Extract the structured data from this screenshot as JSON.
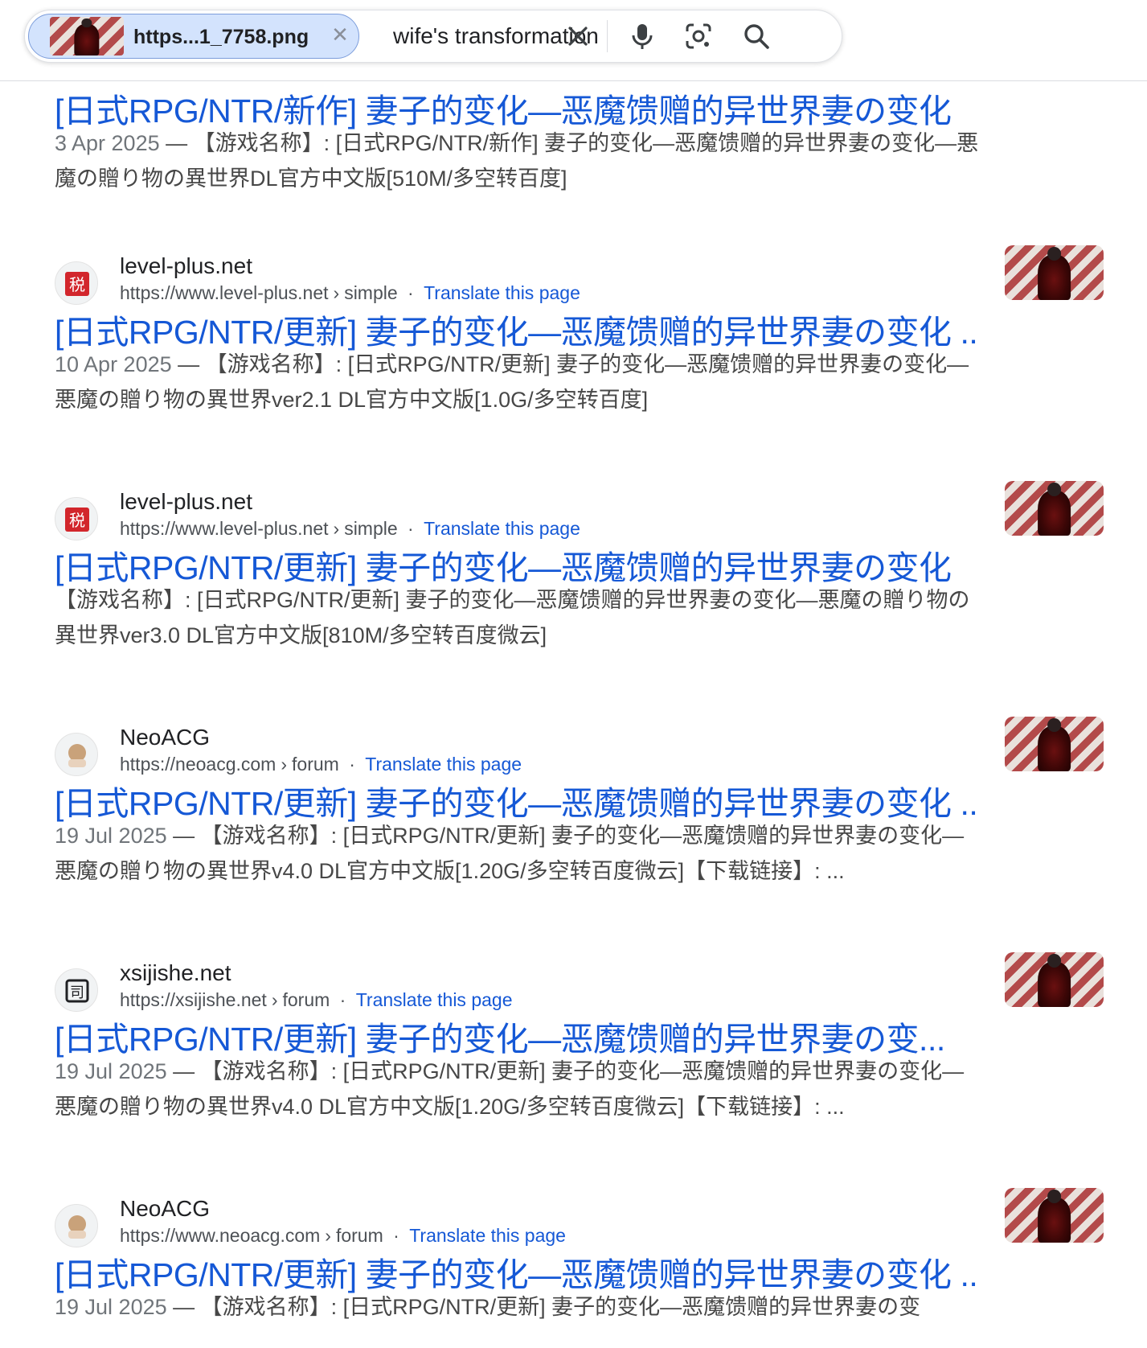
{
  "search": {
    "image_chip_label": "https...1_7758.png",
    "query": "wife's transformation"
  },
  "icons": {
    "chip_close": "close-icon",
    "clear": "close-icon",
    "voice": "microphone-icon",
    "lens": "camera-lens-icon",
    "search": "search-icon"
  },
  "colors": {
    "link_blue": "#1558d6",
    "chip_bg": "#d3e3fd"
  },
  "results": [
    {
      "site_name": "",
      "url": "",
      "breadcrumb": "",
      "translate": "",
      "title": "[日式RPG/NTR/新作] 妻子的变化—恶魔馈赠的异世界妻の变化",
      "date": "3 Apr 2025",
      "snippet": "【游戏名称】: [日式RPG/NTR/新作] 妻子的变化—恶魔馈赠的异世界妻の变化—悪魔の贈り物の異世界DL官方中文版[510M/多空转百度]"
    },
    {
      "site_name": "level-plus.net",
      "url": "https://www.level-plus.net",
      "breadcrumb": "simple",
      "translate": "Translate this page",
      "title": "[日式RPG/NTR/更新] 妻子的变化—恶魔馈赠的异世界妻の变化 ...",
      "date": "10 Apr 2025",
      "snippet": "【游戏名称】: [日式RPG/NTR/更新] 妻子的变化—恶魔馈赠的异世界妻の变化—悪魔の贈り物の異世界ver2.1 DL官方中文版[1.0G/多空转百度]"
    },
    {
      "site_name": "level-plus.net",
      "url": "https://www.level-plus.net",
      "breadcrumb": "simple",
      "translate": "Translate this page",
      "title": "[日式RPG/NTR/更新] 妻子的变化—恶魔馈赠的异世界妻の变化",
      "date": "",
      "snippet": "【游戏名称】: [日式RPG/NTR/更新] 妻子的变化—恶魔馈赠的异世界妻の变化—悪魔の贈り物の異世界ver3.0 DL官方中文版[810M/多空转百度微云]"
    },
    {
      "site_name": "NeoACG",
      "url": "https://neoacg.com",
      "breadcrumb": "forum",
      "translate": "Translate this page",
      "title": "[日式RPG/NTR/更新] 妻子的变化—恶魔馈赠的异世界妻の变化 ...",
      "date": "19 Jul 2025",
      "snippet": "【游戏名称】: [日式RPG/NTR/更新] 妻子的变化—恶魔馈赠的异世界妻の变化—悪魔の贈り物の異世界v4.0 DL官方中文版[1.20G/多空转百度微云]【下载链接】: ..."
    },
    {
      "site_name": "xsijishe.net",
      "url": "https://xsijishe.net",
      "breadcrumb": "forum",
      "translate": "Translate this page",
      "title": "[日式RPG/NTR/更新] 妻子的变化—恶魔馈赠的异世界妻の变...",
      "date": "19 Jul 2025",
      "snippet": "【游戏名称】: [日式RPG/NTR/更新] 妻子的变化—恶魔馈赠的异世界妻の变化—悪魔の贈り物の異世界v4.0 DL官方中文版[1.20G/多空转百度微云]【下载链接】: ..."
    },
    {
      "site_name": "NeoACG",
      "url": "https://www.neoacg.com",
      "breadcrumb": "forum",
      "translate": "Translate this page",
      "title": "[日式RPG/NTR/更新] 妻子的变化—恶魔馈赠的异世界妻の变化 ...",
      "date": "19 Jul 2025",
      "snippet": "【游戏名称】: [日式RPG/NTR/更新] 妻子的变化—恶魔馈赠的异世界妻の变"
    }
  ]
}
